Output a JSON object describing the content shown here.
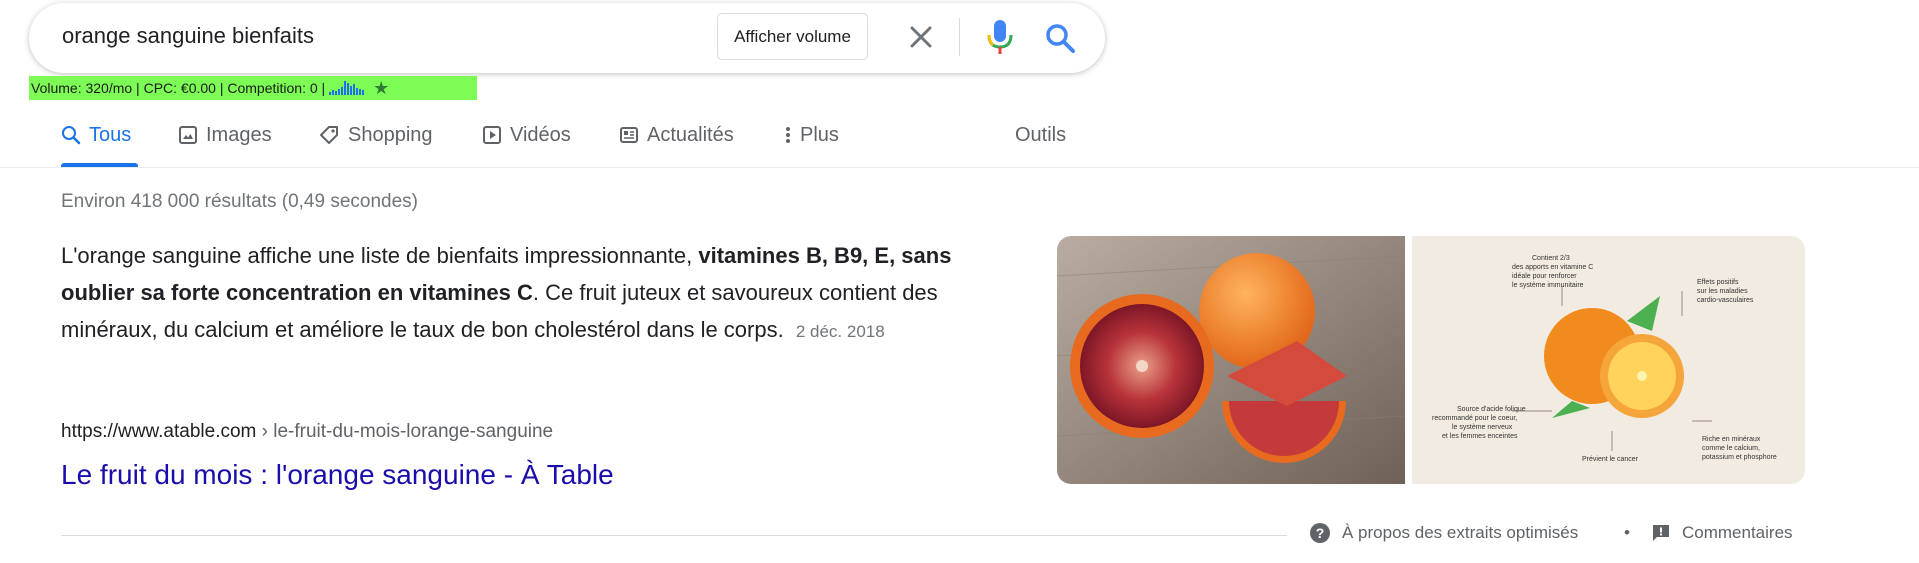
{
  "search": {
    "query": "orange sanguine bienfaits",
    "volume_button": "Afficher volume"
  },
  "keyword_bar": {
    "text": "Volume: 320/mo | CPC: €0.00 | Competition: 0 |",
    "trend": [
      3,
      5,
      4,
      6,
      8,
      14,
      12,
      9,
      11,
      7,
      6,
      5
    ]
  },
  "tabs": [
    {
      "label": "Tous",
      "icon": "search-icon",
      "active": true
    },
    {
      "label": "Images",
      "icon": "image-icon"
    },
    {
      "label": "Shopping",
      "icon": "tag-icon"
    },
    {
      "label": "Vidéos",
      "icon": "play-icon"
    },
    {
      "label": "Actualités",
      "icon": "news-icon"
    },
    {
      "label": "Plus",
      "icon": "more-vert-icon"
    }
  ],
  "tools_label": "Outils",
  "stats": "Environ 418 000 résultats (0,49 secondes)",
  "snippet": {
    "part1": "L'orange sanguine affiche une liste de bienfaits impressionnante, ",
    "bold": "vitamines B, B9, E, sans oublier sa forte concentration en vitamines C",
    "part2": ". Ce fruit juteux et savoureux contient des minéraux, du calcium et améliore le taux de bon cholestérol dans le corps.",
    "date": "2 déc. 2018"
  },
  "result": {
    "url_domain": "https://www.atable.com",
    "url_path": " › le-fruit-du-mois-lorange-sanguine",
    "title": "Le fruit du mois : l'orange sanguine - À Table"
  },
  "infographic": {
    "label_1": "Contient 2/3",
    "label_1b": "des apports en vitamine C",
    "label_1c": "idéale pour renforcer",
    "label_1d": "le système immunitaire",
    "label_2": "Effets positifs",
    "label_2b": "sur les maladies",
    "label_2c": "cardio-vasculaires",
    "label_3": "Source d'acide folique",
    "label_3b": "recommandé pour le coeur,",
    "label_3c": "le système nerveux",
    "label_3d": "et les femmes enceintes",
    "label_4": "Prévient le cancer",
    "label_5": "Riche en minéraux",
    "label_5b": "comme le calcium,",
    "label_5c": "potassium et phosphore"
  },
  "footer": {
    "about_label": "À propos des extraits optimisés",
    "separator": "•",
    "feedback_label": "Commentaires"
  },
  "colors": {
    "accent": "#1a73e8",
    "link": "#1a0dab",
    "keyword_bar": "#7CFC55"
  }
}
